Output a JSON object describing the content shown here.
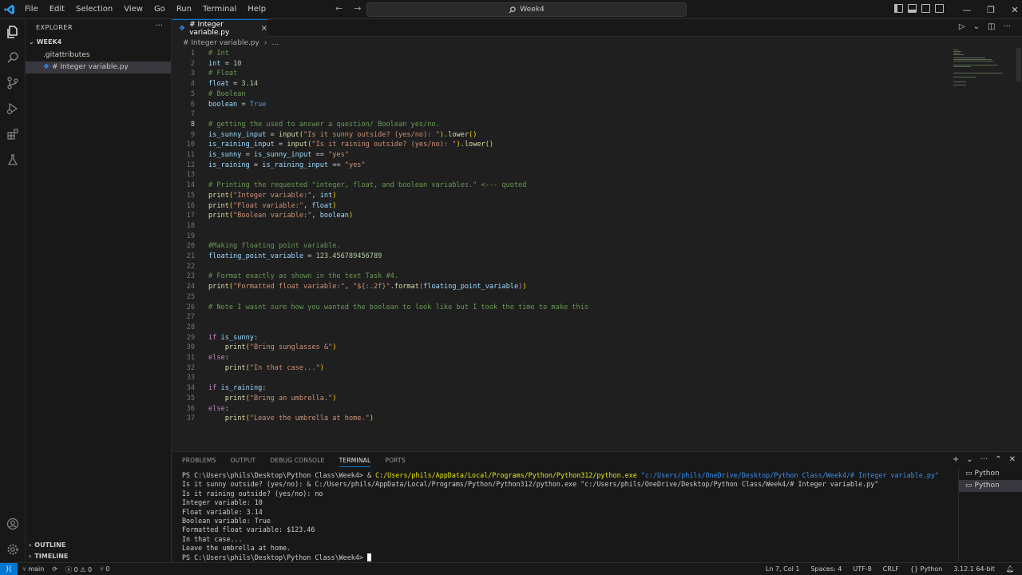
{
  "title_bar": {
    "menu": [
      "File",
      "Edit",
      "Selection",
      "View",
      "Go",
      "Run",
      "Terminal",
      "Help"
    ],
    "search_text": "Week4"
  },
  "sidebar": {
    "title": "EXPLORER",
    "folder": "WEEK4",
    "files": [
      ".gitattributes",
      "# Integer variable.py"
    ],
    "outline": "OUTLINE",
    "timeline": "TIMELINE"
  },
  "tab": {
    "label": "# Integer variable.py",
    "close": "×"
  },
  "breadcrumb": {
    "file": "# Integer variable.py",
    "more": "..."
  },
  "editor": {
    "current_line": 8,
    "lines": [
      "# Int",
      "int = 10",
      "# Float",
      "float = 3.14",
      "# Boolean",
      "boolean = True",
      "",
      "# getting the used to answer a question/ Boolean yes/no.",
      "is_sunny_input = input(\"Is it sunny outside? (yes/no): \").lower()",
      "is_raining_input = input(\"Is it raining outside? (yes/no): \").lower()",
      "is_sunny = is_sunny_input == \"yes\"",
      "is_raining = is_raining_input == \"yes\"",
      "",
      "# Printing the requested \"integer, float, and boolean variables.\" <--- quoted",
      "print(\"Integer variable:\", int)",
      "print(\"Float variable:\", float)",
      "print(\"Boolean variable:\", boolean)",
      "",
      "",
      "#Making floating point variable.",
      "floating_point_variable = 123.456789456789",
      "",
      "# Format exactly as shown in the text Task #4.",
      "print(\"Formatted float variable:\", \"${:.2f}\".format(floating_point_variable))",
      "",
      "# Note I wasnt sure how you wanted the boolean to look like but I took the time to make this",
      "",
      "",
      "if is_sunny:",
      "    print(\"Bring sunglasses &\")",
      "else:",
      "    print(\"In that case...\")",
      "",
      "if is_raining:",
      "    print(\"Bring an umbrella.\")",
      "else:",
      "    print(\"Leave the umbrella at home.\")"
    ]
  },
  "panel": {
    "tabs": [
      "PROBLEMS",
      "OUTPUT",
      "DEBUG CONSOLE",
      "TERMINAL",
      "PORTS"
    ],
    "active_tab": "TERMINAL",
    "terminals": [
      "Python",
      "Python"
    ],
    "lines": {
      "l0_prompt": "PS C:\\Users\\phils\\Desktop\\Python Class\\Week4> ",
      "l0_amp": "& ",
      "l0_exe": "C:/Users/phils/AppData/Local/Programs/Python/Python312/python.exe",
      "l0_path": " \"c:/Users/phils/OneDrive/Desktop/Python Class/Week4/# Integer variable.py\"",
      "l1": "Is it sunny outside? (yes/no): & C:/Users/phils/AppData/Local/Programs/Python/Python312/python.exe \"c:/Users/phils/OneDrive/Desktop/Python Class/Week4/# Integer variable.py\"",
      "l2": "Is it raining outside? (yes/no): no",
      "l3": "Integer variable: 10",
      "l4": "Float variable: 3.14",
      "l5": "Boolean variable: True",
      "l6": "Formatted float variable: $123.46",
      "l7": "In that case...",
      "l8": "Leave the umbrella at home.",
      "l9": "PS C:\\Users\\phils\\Desktop\\Python Class\\Week4> "
    }
  },
  "status_bar": {
    "branch": "main",
    "errors": "0",
    "warnings": "0",
    "ports": "0",
    "position": "Ln 7, Col 1",
    "spaces": "Spaces: 4",
    "encoding": "UTF-8",
    "eol": "CRLF",
    "language": "Python",
    "interpreter": "3.12.1 64-bit"
  },
  "colors": {
    "accent": "#0078d4",
    "background": "#1f1f1f",
    "chrome": "#181818"
  }
}
